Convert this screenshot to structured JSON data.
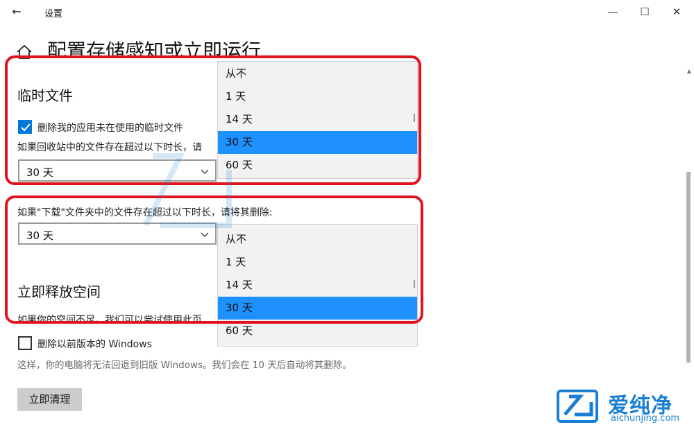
{
  "window": {
    "title": "设置",
    "back_glyph": "←",
    "minimize_glyph": "—",
    "maximize_glyph": "☐",
    "close_glyph": "✕"
  },
  "page": {
    "title": "配置存储感知或立即运行"
  },
  "temp_files": {
    "heading": "临时文件",
    "delete_unused_label": "删除我的应用未在使用的临时文件",
    "delete_unused_checked": true,
    "recycle_prompt": "如果回收站中的文件存在超过以下时长，请",
    "recycle_value": "30 天"
  },
  "downloads": {
    "prompt": "如果\"下载\"文件夹中的文件存在超过以下时长，请将其删除:",
    "value": "30 天"
  },
  "dropdown_options": [
    "从不",
    "1 天",
    "14 天",
    "30 天",
    "60 天"
  ],
  "dropdown_selected": "30 天",
  "free_space": {
    "heading": "立即释放空间",
    "desc": "如果你的空间不足，我们可以尝试使用此页",
    "delete_prev_label": "删除以前版本的 Windows",
    "delete_prev_checked": false,
    "note": "这样，你的电脑将无法回退到旧版 Windows。我们会在 10 天后自动将其删除。",
    "clean_button": "立即清理"
  },
  "watermark": {
    "brand": "爱纯净",
    "site": "aichunjing.com"
  },
  "colors": {
    "accent": "#0078d7",
    "selected_item": "#1e90ff",
    "callout": "#e0141e",
    "brand": "#1a7fd4"
  },
  "icons": [
    "back-arrow-icon",
    "home-icon",
    "checkmark-icon",
    "chevron-down-icon",
    "brand-logo-icon"
  ]
}
